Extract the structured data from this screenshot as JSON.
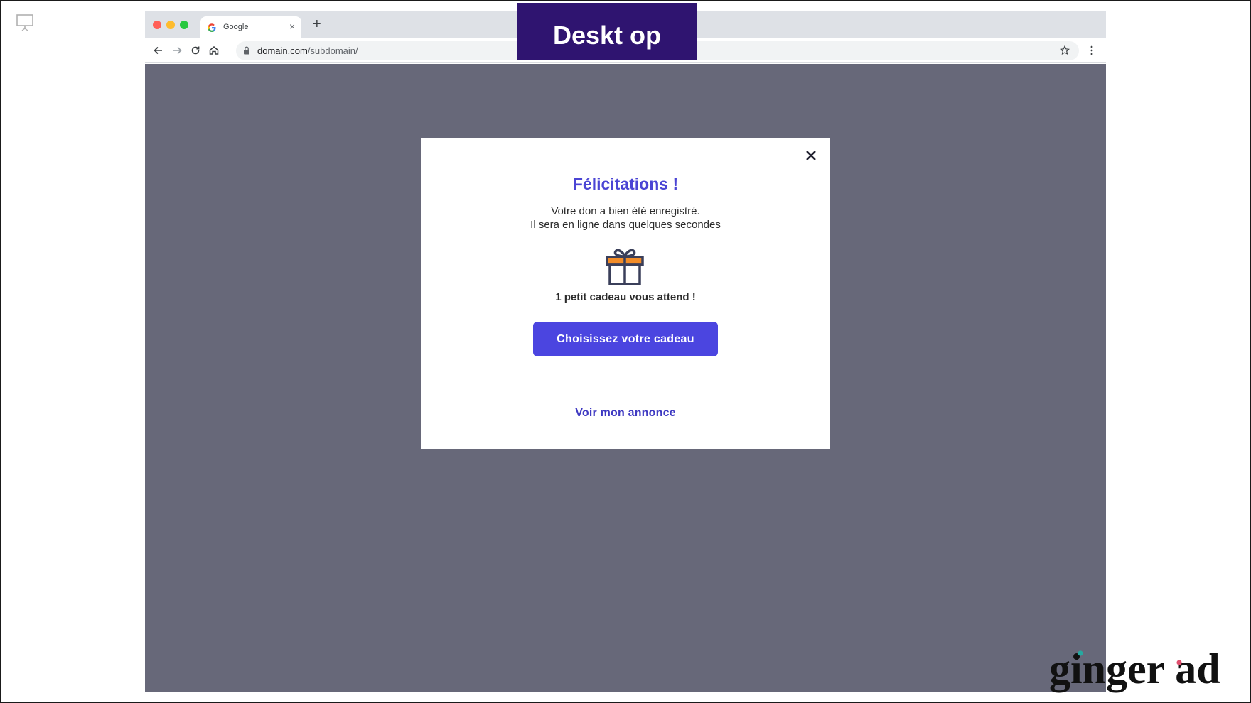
{
  "slide": {
    "label": "Deskt op",
    "logo_text": "ginger ad"
  },
  "browser": {
    "tab_title": "Google",
    "url_domain": "domain.com",
    "url_path": "/subdomain/"
  },
  "modal": {
    "title": "Félicitations !",
    "message_line1": "Votre don a bien été enregistré.",
    "message_line2": "Il sera en ligne dans quelques secondes",
    "gift_text": "1 petit cadeau vous attend !",
    "cta_label": "Choisissez votre cadeau",
    "link_label": "Voir mon annonce"
  },
  "colors": {
    "accent": "#4b45e0",
    "title": "#4b45d4",
    "overlay": "#676879",
    "label_bg": "#2f1470",
    "gift_orange": "#f28c28"
  },
  "icons": [
    "presentation-icon",
    "google-favicon",
    "close-icon",
    "plus-icon",
    "back-icon",
    "forward-icon",
    "reload-icon",
    "home-icon",
    "lock-icon",
    "star-icon",
    "kebab-menu-icon",
    "gift-icon"
  ]
}
